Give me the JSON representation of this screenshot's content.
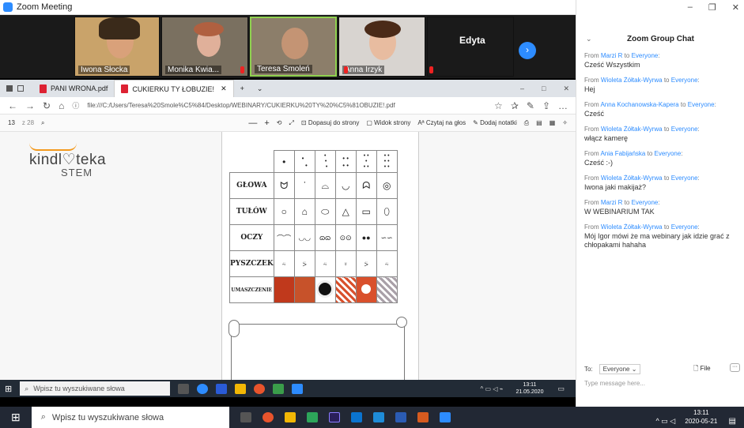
{
  "zoom": {
    "title": "Zoom Meeting"
  },
  "participants": [
    {
      "name": "Iwona Słocka"
    },
    {
      "name": "Monika Kwia..."
    },
    {
      "name": "Teresa Smoleń"
    },
    {
      "name": "Anna Irzyk"
    },
    {
      "name": "Edyta"
    }
  ],
  "browser": {
    "tabs": [
      {
        "label": "PANI WRONA.pdf"
      },
      {
        "label": "CUKIERKU TY ŁOBUZIE!"
      }
    ],
    "url": "file:///C:/Users/Teresa%20Smole%C5%84/Desktop/WEBINARY/CUKIERKU%20TY%20%C5%81OBUZIE!.pdf",
    "page_num": "13",
    "page_total": "z 28",
    "toolbar": {
      "fit": "Dopasuj do strony",
      "view": "Widok strony",
      "read": "Czytaj na głos",
      "note": "Dodaj notatki"
    }
  },
  "document": {
    "brand_top": "kindl♡teka",
    "brand_bottom": "STEM",
    "rows": [
      "GŁOWA",
      "TUŁÓW",
      "OCZY",
      "PYSZCZEK",
      "UMASZCZENIE"
    ]
  },
  "chat": {
    "title": "Zoom Group Chat",
    "messages": [
      {
        "from": "Marzi R",
        "to": "Everyone",
        "text": "Cześć Wszystkim"
      },
      {
        "from": "Wioleta Żółtak-Wyrwa",
        "to": "Everyone",
        "text": "Hej"
      },
      {
        "from": "Anna Kochanowska-Kapera",
        "to": "Everyone",
        "text": "Cześć"
      },
      {
        "from": "Wioleta Żółtak-Wyrwa",
        "to": "Everyone",
        "text": "włącz kamerę"
      },
      {
        "from": "Ania Fabijańska",
        "to": "Everyone",
        "text": "Cześć :-)"
      },
      {
        "from": "Wioleta Żółtak-Wyrwa",
        "to": "Everyone",
        "text": "Iwona jaki makijaż?"
      },
      {
        "from": "Marzi R",
        "to": "Everyone",
        "text": "W WEBINARIUM TAK"
      },
      {
        "from": "Wioleta Żółtak-Wyrwa",
        "to": "Everyone",
        "text": "Mój Igor mówi że ma webinary jak idzie grać z chłopakami hahaha"
      }
    ],
    "to_label": "To:",
    "to_value": "Everyone",
    "file_label": "File",
    "input_placeholder": "Type message here..."
  },
  "taskbar_inner": {
    "search": "Wpisz tu wyszukiwane słowa",
    "time": "13:11",
    "date": "21.05.2020"
  },
  "taskbar": {
    "search": "Wpisz tu wyszukiwane słowa",
    "time": "13:11",
    "date": "2020-05-21"
  },
  "colors": {
    "zoom_blue": "#2d8cff",
    "taskbar": "#222834"
  }
}
